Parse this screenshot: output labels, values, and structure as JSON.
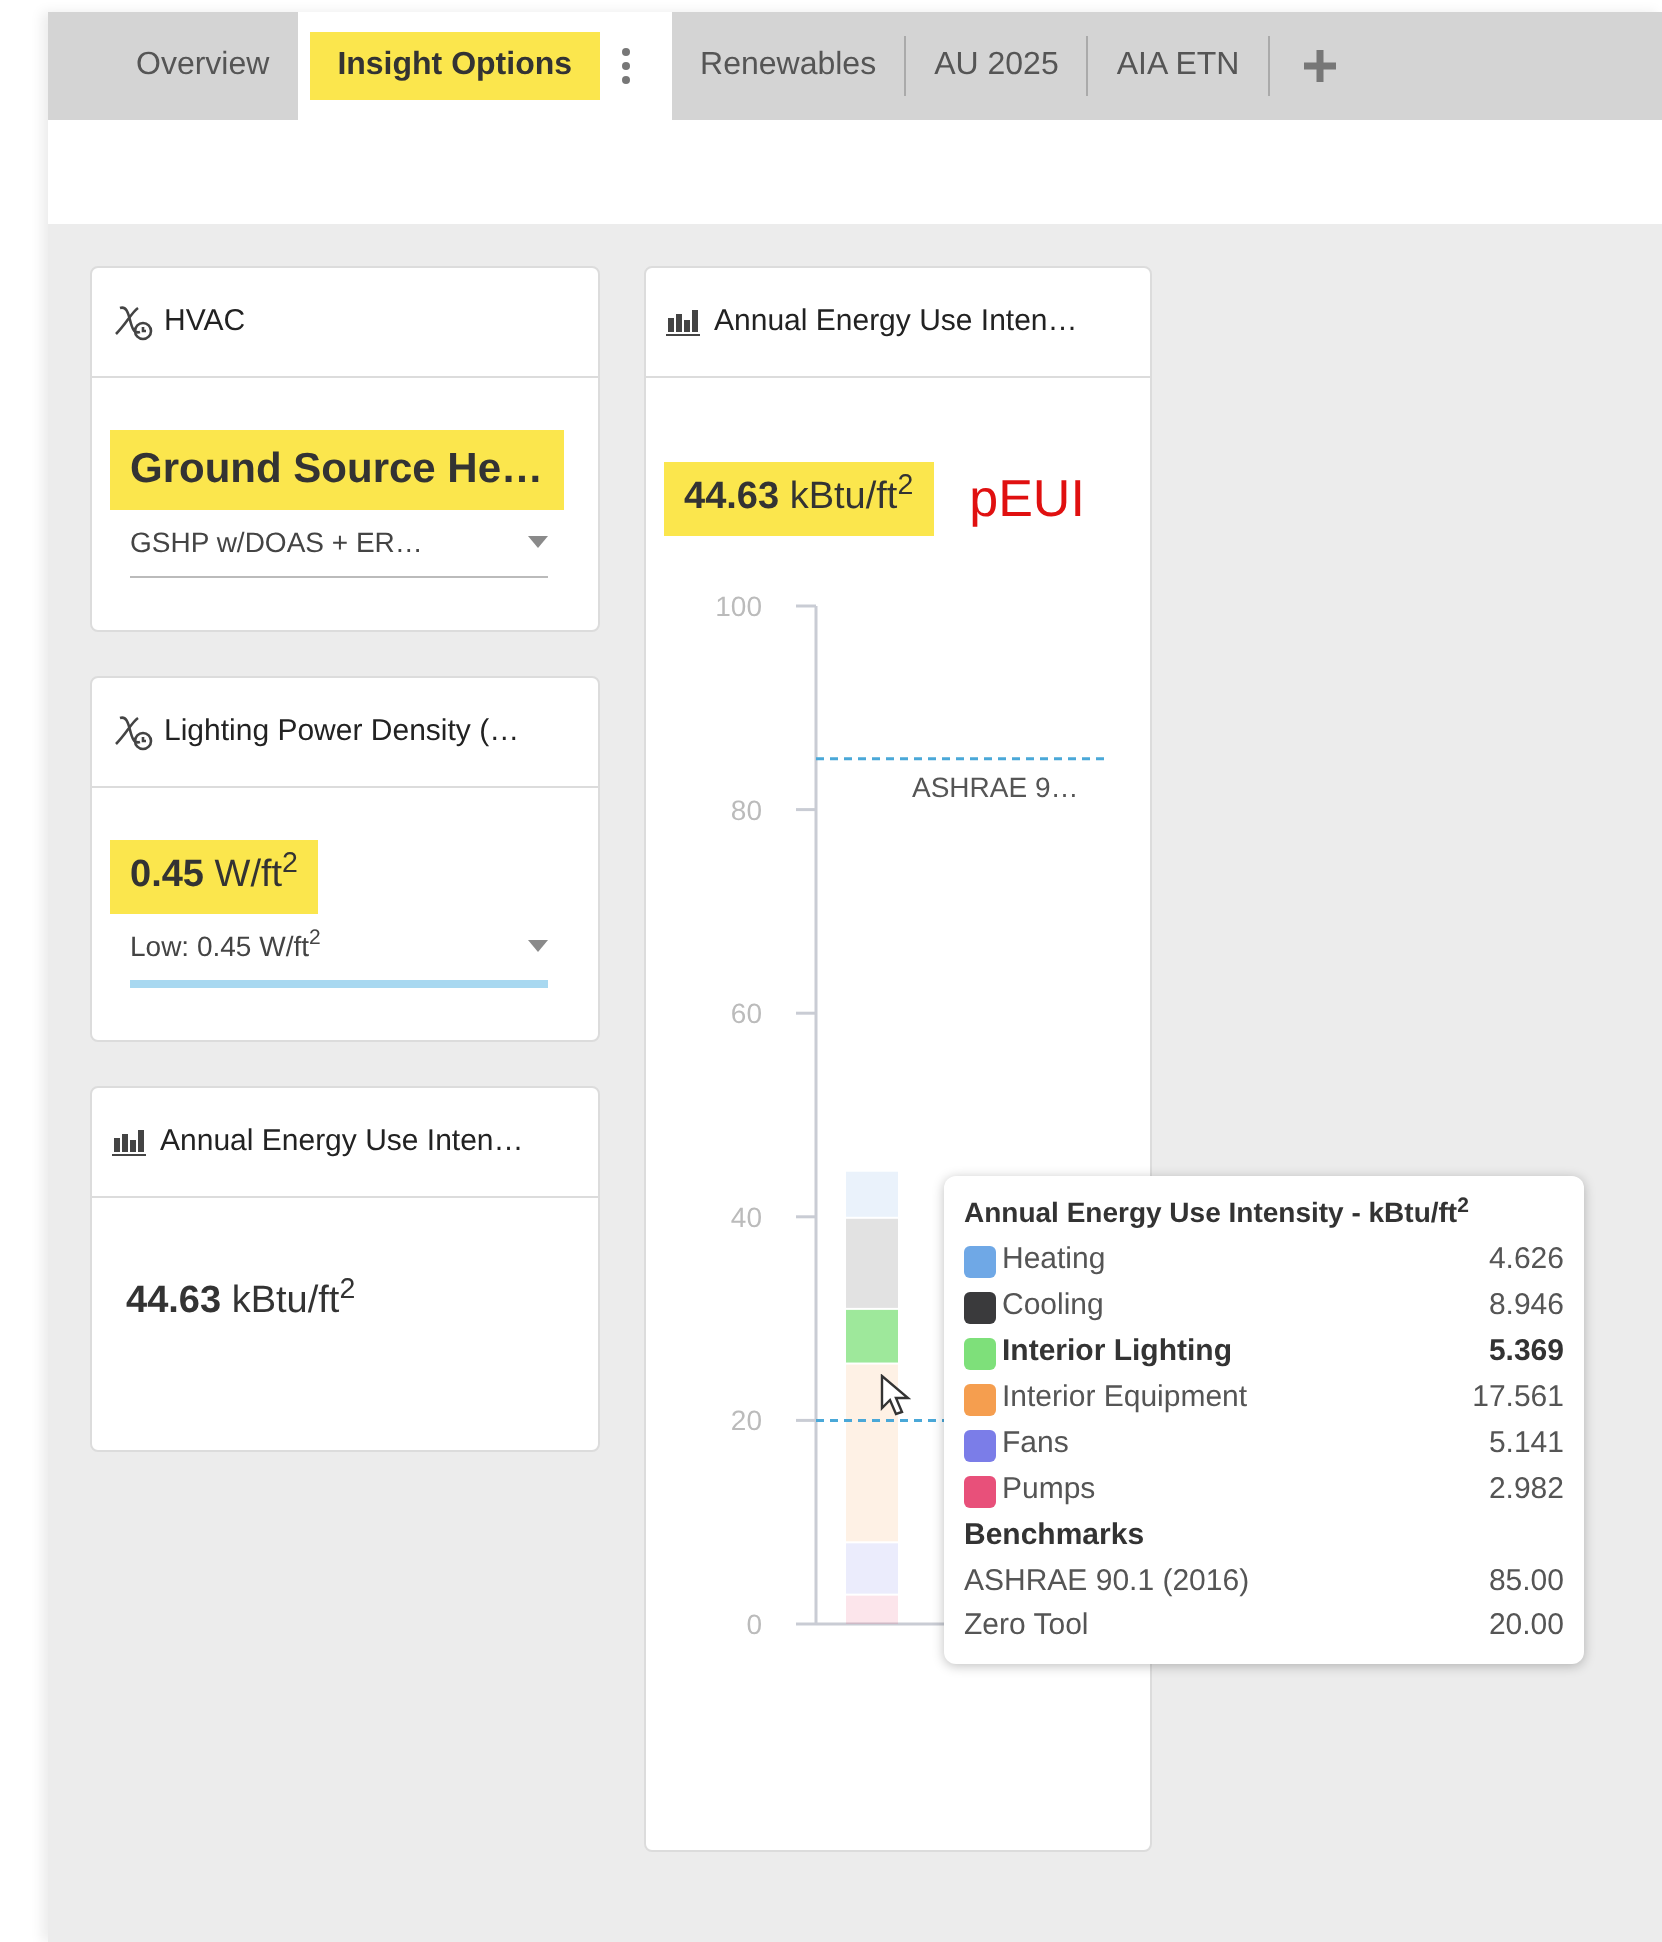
{
  "tabs": [
    {
      "label": "Overview",
      "selected": false,
      "highlighted": false
    },
    {
      "label": "Insight Options",
      "selected": true,
      "highlighted": true
    },
    {
      "label": "Renewables",
      "selected": false,
      "highlighted": false
    },
    {
      "label": "AU 2025",
      "selected": false,
      "highlighted": false
    },
    {
      "label": "AIA ETN",
      "selected": false,
      "highlighted": false
    }
  ],
  "left_cards": [
    {
      "kind": "setting",
      "title": "HVAC",
      "value": "Ground Source He…",
      "highlighted": true,
      "dropdown": {
        "value": "GSHP w/DOAS + ER…",
        "focused": false
      }
    },
    {
      "kind": "setting",
      "title": "Lighting Power Density (…",
      "value": "0.45",
      "unit": "W/ft$^{2}$",
      "highlighted": true,
      "dropdown": {
        "value": "Low: 0.45 W/ft$^{2}$",
        "focused": true
      }
    },
    {
      "kind": "metric",
      "title": "Annual Energy Use Inten…",
      "value": "44.63",
      "unit": "kBtu/ft$^{2}$",
      "highlighted": false
    }
  ],
  "chart_card": {
    "title": "Annual Energy Use Inten…",
    "value": "44.63",
    "unit": "kBtu/ft$^{2}$",
    "highlighted": true,
    "annotation": "pEUI",
    "chart_data": {
      "type": "bar",
      "stacked": true,
      "ylim": [
        0,
        100
      ],
      "yticks": [
        0,
        20,
        40,
        60,
        80,
        100
      ],
      "series": [
        {
          "name": "Pumps",
          "color": "#e8507a",
          "values": [
            2.982
          ]
        },
        {
          "name": "Fans",
          "color": "#7b7de8",
          "values": [
            5.141
          ]
        },
        {
          "name": "Interior Equipment",
          "color": "#f59e4f",
          "values": [
            17.561
          ]
        },
        {
          "name": "Interior Lighting",
          "color": "#7ee07a",
          "values": [
            5.369
          ]
        },
        {
          "name": "Cooling",
          "color": "#3a3a3c",
          "values": [
            8.946
          ]
        },
        {
          "name": "Heating",
          "color": "#6fa8e6",
          "values": [
            4.626
          ]
        }
      ],
      "ref_lines": [
        {
          "axis": "y",
          "value": 85,
          "label": "ASHRAE 9…"
        },
        {
          "axis": "y",
          "value": 20
        }
      ]
    },
    "tooltip": {
      "title": "Annual Energy Use Intensity - kBtu/ft$^{2}$",
      "rows": [
        {
          "value": "4.626",
          "selected": false
        },
        {
          "value": "8.946",
          "selected": false
        },
        {
          "value": "5.369",
          "selected": true
        },
        {
          "value": "17.561",
          "selected": false
        },
        {
          "value": "5.141",
          "selected": false
        },
        {
          "value": "2.982",
          "selected": false
        }
      ],
      "section": "Benchmarks",
      "benchmarks": [
        {
          "label": "ASHRAE 90.1 (2016)",
          "value": "85.00"
        },
        {
          "label": "Zero Tool",
          "value": "20.00"
        }
      ]
    }
  }
}
